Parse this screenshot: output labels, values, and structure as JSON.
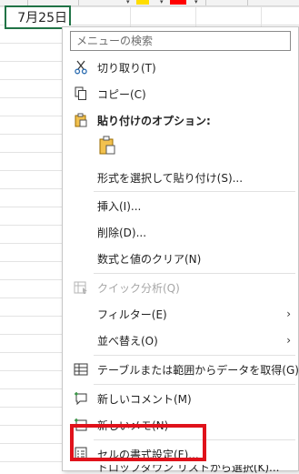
{
  "cell": {
    "value": "7月25日"
  },
  "colors": {
    "accent": "#217346",
    "highlight": "#e0121b",
    "swatch_yellow": "#ffdd00",
    "swatch_red": "#ff0000"
  },
  "menu": {
    "search_placeholder": "メニューの検索",
    "items": [
      {
        "label": "切り取り(T)",
        "icon": "scissors-icon"
      },
      {
        "label": "コピー(C)",
        "icon": "copy-icon"
      },
      {
        "label": "貼り付けのオプション:",
        "icon": "paste-options-icon"
      },
      {
        "label": "形式を選択して貼り付け(S)...",
        "icon": ""
      },
      {
        "label": "挿入(I)...",
        "icon": ""
      },
      {
        "label": "削除(D)...",
        "icon": ""
      },
      {
        "label": "数式と値のクリア(N)",
        "icon": ""
      },
      {
        "label": "クイック分析(Q)",
        "icon": "quick-analysis-icon",
        "disabled": true
      },
      {
        "label": "フィルター(E)",
        "icon": "",
        "submenu": true
      },
      {
        "label": "並べ替え(O)",
        "icon": "",
        "submenu": true
      },
      {
        "label": "テーブルまたは範囲からデータを取得(G)...",
        "icon": "table-icon"
      },
      {
        "label": "新しいコメント(M)",
        "icon": "new-comment-icon"
      },
      {
        "label": "新しいメモ(N)",
        "icon": "new-note-icon"
      },
      {
        "label": "セルの書式設定(F)...",
        "icon": "format-cells-icon"
      },
      {
        "label": "ドロップダウン リストから選択(K)...",
        "icon": ""
      }
    ],
    "submenu_arrow": "›"
  }
}
